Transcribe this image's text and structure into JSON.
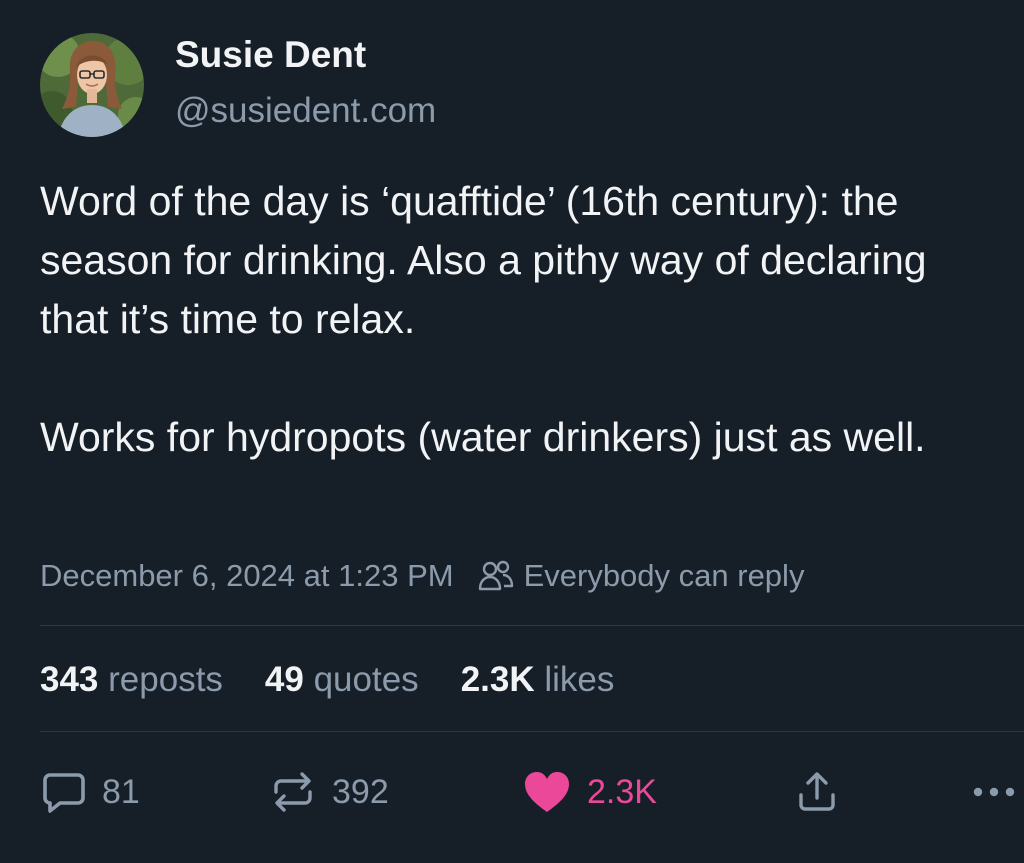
{
  "author": {
    "display_name": "Susie Dent",
    "handle": "@susiedent.com"
  },
  "post": {
    "paragraphs": [
      "Word of the day is ‘quafftide’ (16th century): the season for drinking. Also a pithy way of declaring that it’s time to relax.",
      "Works for hydropots (water drinkers) just as well."
    ],
    "timestamp": "December 6, 2024 at 1:23 PM",
    "reply_setting": "Everybody can reply"
  },
  "stats": {
    "reposts": {
      "count": "343",
      "label": "reposts"
    },
    "quotes": {
      "count": "49",
      "label": "quotes"
    },
    "likes": {
      "count": "2.3K",
      "label": "likes"
    }
  },
  "actions": {
    "reply_count": "81",
    "repost_count": "392",
    "like_count": "2.3K",
    "like_active": true
  },
  "colors": {
    "background": "#161e27",
    "text_primary": "#f1f3f5",
    "text_secondary": "#8c9bab",
    "like_accent": "#ec4899",
    "divider": "#2a3744"
  },
  "icons": {
    "reply": "speech-bubble-icon",
    "repost": "repost-arrows-icon",
    "like": "heart-icon",
    "share": "share-upload-icon",
    "more": "ellipsis-icon",
    "reply_setting": "people-icon"
  }
}
